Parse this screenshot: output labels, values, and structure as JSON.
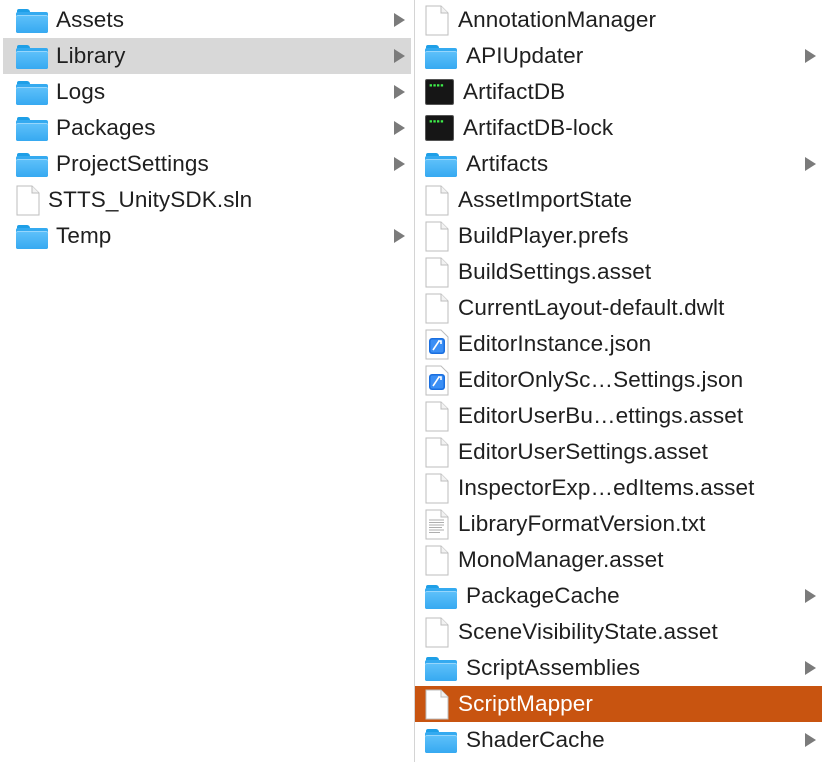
{
  "columns": [
    {
      "items": [
        {
          "label": "Assets",
          "icon": "folder-icon",
          "has_children": true,
          "selected": "none"
        },
        {
          "label": "Library",
          "icon": "folder-icon",
          "has_children": true,
          "selected": "inactive"
        },
        {
          "label": "Logs",
          "icon": "folder-icon",
          "has_children": true,
          "selected": "none"
        },
        {
          "label": "Packages",
          "icon": "folder-icon",
          "has_children": true,
          "selected": "none"
        },
        {
          "label": "ProjectSettings",
          "icon": "folder-icon",
          "has_children": true,
          "selected": "none"
        },
        {
          "label": "STTS_UnitySDK.sln",
          "icon": "document-icon",
          "has_children": false,
          "selected": "none"
        },
        {
          "label": "Temp",
          "icon": "folder-icon",
          "has_children": true,
          "selected": "none"
        }
      ]
    },
    {
      "items": [
        {
          "label": "AnnotationManager",
          "icon": "document-icon",
          "has_children": false,
          "selected": "none"
        },
        {
          "label": "APIUpdater",
          "icon": "folder-icon",
          "has_children": true,
          "selected": "none"
        },
        {
          "label": "ArtifactDB",
          "icon": "terminal-icon",
          "has_children": false,
          "selected": "none"
        },
        {
          "label": "ArtifactDB-lock",
          "icon": "terminal-icon",
          "has_children": false,
          "selected": "none"
        },
        {
          "label": "Artifacts",
          "icon": "folder-icon",
          "has_children": true,
          "selected": "none"
        },
        {
          "label": "AssetImportState",
          "icon": "document-icon",
          "has_children": false,
          "selected": "none"
        },
        {
          "label": "BuildPlayer.prefs",
          "icon": "document-icon",
          "has_children": false,
          "selected": "none"
        },
        {
          "label": "BuildSettings.asset",
          "icon": "document-icon",
          "has_children": false,
          "selected": "none"
        },
        {
          "label": "CurrentLayout-default.dwlt",
          "icon": "document-icon",
          "has_children": false,
          "selected": "none"
        },
        {
          "label": "EditorInstance.json",
          "icon": "json-document-icon",
          "has_children": false,
          "selected": "none"
        },
        {
          "label": "EditorOnlySc…Settings.json",
          "icon": "json-document-icon",
          "has_children": false,
          "selected": "none"
        },
        {
          "label": "EditorUserBu…ettings.asset",
          "icon": "document-icon",
          "has_children": false,
          "selected": "none"
        },
        {
          "label": "EditorUserSettings.asset",
          "icon": "document-icon",
          "has_children": false,
          "selected": "none"
        },
        {
          "label": "InspectorExp…edItems.asset",
          "icon": "document-icon",
          "has_children": false,
          "selected": "none"
        },
        {
          "label": "LibraryFormatVersion.txt",
          "icon": "text-document-icon",
          "has_children": false,
          "selected": "none"
        },
        {
          "label": "MonoManager.asset",
          "icon": "document-icon",
          "has_children": false,
          "selected": "none"
        },
        {
          "label": "PackageCache",
          "icon": "folder-icon",
          "has_children": true,
          "selected": "none"
        },
        {
          "label": "SceneVisibilityState.asset",
          "icon": "document-icon",
          "has_children": false,
          "selected": "none"
        },
        {
          "label": "ScriptAssemblies",
          "icon": "folder-icon",
          "has_children": true,
          "selected": "none"
        },
        {
          "label": "ScriptMapper",
          "icon": "document-icon",
          "has_children": false,
          "selected": "active"
        },
        {
          "label": "ShaderCache",
          "icon": "folder-icon",
          "has_children": true,
          "selected": "none"
        }
      ]
    }
  ],
  "colors": {
    "selected_active": "#c85410",
    "selected_inactive": "#d8d8d8",
    "folder": "#4fb7f6",
    "terminal_prompt": "#3ef04a"
  }
}
